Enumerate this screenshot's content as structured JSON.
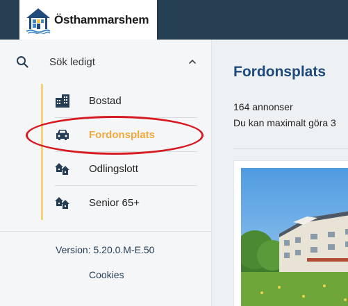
{
  "header": {
    "logo_text": "Östhammarshem",
    "logo_icon": "house-logo-icon"
  },
  "sidebar": {
    "search": {
      "label": "Sök ledigt",
      "icon": "search-icon",
      "toggle_icon": "chevron-up-icon"
    },
    "items": [
      {
        "label": "Bostad",
        "icon": "building-icon",
        "active": false
      },
      {
        "label": "Fordonsplats",
        "icon": "car-icon",
        "active": true
      },
      {
        "label": "Odlingslott",
        "icon": "houses-icon",
        "active": false
      },
      {
        "label": "Senior 65+",
        "icon": "houses-icon",
        "active": false
      }
    ],
    "version": "Version: 5.20.0.M-E.50",
    "cookies": "Cookies"
  },
  "main": {
    "title": "Fordonsplats",
    "count_text": "164 annonser",
    "info_text": "Du kan maximalt göra 3"
  },
  "colors": {
    "topbar": "#263f52",
    "active_accent": "#f1a93c",
    "nav_rail": "#f4d27a",
    "title": "#1f4a7c",
    "highlight": "#d71920"
  }
}
